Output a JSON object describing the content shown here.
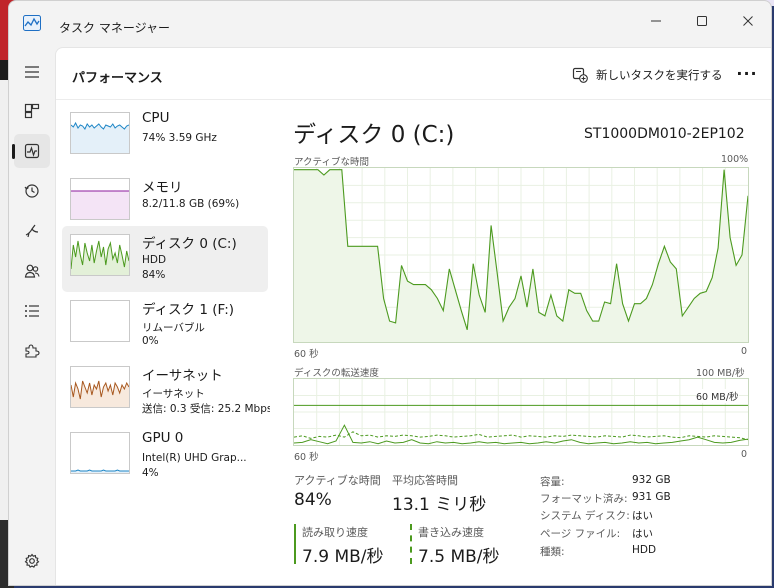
{
  "window": {
    "title": "タスク マネージャー"
  },
  "header": {
    "title": "パフォーマンス",
    "new_task_label": "新しいタスクを実行する",
    "more_label": "···"
  },
  "nav": {
    "items": [
      "menu-icon",
      "processes-icon",
      "performance-icon",
      "app-history-icon",
      "startup-icon",
      "users-icon",
      "details-icon",
      "services-icon",
      "settings-icon"
    ]
  },
  "devices": [
    {
      "name": "CPU",
      "line1": "74%  3.59 GHz",
      "line2": "",
      "color": "#1e86c6",
      "fill": "#e4f0f9"
    },
    {
      "name": "メモリ",
      "line1": "8.2/11.8 GB (69%)",
      "line2": "",
      "color": "#8b1b9c",
      "fill": "#f4e4f6"
    },
    {
      "name": "ディスク 0 (C:)",
      "line1": "HDD",
      "line2": "84%",
      "color": "#4c9a1f",
      "fill": "#e3f0d8"
    },
    {
      "name": "ディスク 1 (F:)",
      "line1": "リムーバブル",
      "line2": "0%",
      "color": "#4c9a1f",
      "fill": "#e3f0d8"
    },
    {
      "name": "イーサネット",
      "line1": "イーサネット",
      "line2": "送信: 0.3  受信: 25.2 Mbps",
      "color": "#a8581f",
      "fill": "#f7e9dd"
    },
    {
      "name": "GPU 0",
      "line1": "Intel(R) UHD Grap...",
      "line2": "4%",
      "color": "#1e86c6",
      "fill": "#e4f0f9"
    }
  ],
  "detail": {
    "title": "ディスク 0 (C:)",
    "model": "ST1000DM010-2EP102",
    "active_time_label": "アクティブな時間",
    "active_time_max": "100%",
    "x_left": "60 秒",
    "x_right": "0",
    "transfer_label": "ディスクの転送速度",
    "transfer_max": "100 MB/秒",
    "transfer_ref": "60 MB/秒",
    "x_left2": "60 秒",
    "x_right2": "0"
  },
  "stats": {
    "active_time_label": "アクティブな時間",
    "active_time_value": "84%",
    "response_label": "平均応答時間",
    "response_value": "13.1 ミリ秒",
    "read_label": "読み取り速度",
    "read_value": "7.9 MB/秒",
    "write_label": "書き込み速度",
    "write_value": "7.5 MB/秒"
  },
  "properties": [
    {
      "label": "容量:",
      "value": "932 GB"
    },
    {
      "label": "フォーマット済み:",
      "value": "931 GB"
    },
    {
      "label": "システム ディスク:",
      "value": "はい"
    },
    {
      "label": "ページ ファイル:",
      "value": "はい"
    },
    {
      "label": "種類:",
      "value": "HDD"
    }
  ],
  "chart_data": [
    {
      "type": "area",
      "title": "アクティブな時間",
      "ylim": [
        0,
        100
      ],
      "y_unit": "%",
      "x_label_left": "60 秒",
      "x_label_right": "0",
      "values": [
        99,
        99,
        99,
        99,
        99,
        96,
        99,
        99,
        99,
        55,
        55,
        55,
        55,
        55,
        55,
        25,
        12,
        11,
        44,
        35,
        33,
        33,
        33,
        30,
        25,
        18,
        42,
        30,
        18,
        7,
        45,
        27,
        17,
        67,
        40,
        12,
        20,
        25,
        38,
        20,
        42,
        17,
        15,
        27,
        15,
        12,
        30,
        28,
        28,
        18,
        12,
        12,
        23,
        22,
        45,
        22,
        12,
        22,
        22,
        25,
        33,
        45,
        55,
        46,
        42,
        15,
        20,
        25,
        28,
        29,
        37,
        54,
        99,
        60,
        44,
        50,
        84
      ]
    },
    {
      "type": "line",
      "title": "ディスクの転送速度",
      "ylim": [
        0,
        100
      ],
      "y_unit": "MB/秒",
      "reference_line": 60,
      "x_label_left": "60 秒",
      "x_label_right": "0",
      "series": [
        {
          "name": "読み取り速度",
          "style": "solid",
          "values": [
            3,
            4,
            8,
            5,
            2,
            6,
            30,
            4,
            3,
            5,
            2,
            6,
            3,
            4,
            8,
            3,
            2,
            5,
            3,
            4,
            2,
            3,
            5,
            3,
            4,
            2,
            3,
            4,
            2,
            3,
            5,
            3,
            6,
            8,
            4,
            2,
            3,
            4,
            2,
            3,
            5,
            3,
            4,
            2,
            3,
            4,
            6,
            8,
            12,
            8,
            4,
            3,
            4,
            7,
            9
          ]
        },
        {
          "name": "書き込み速度",
          "style": "dashed",
          "values": [
            12,
            14,
            10,
            13,
            12,
            15,
            12,
            20,
            14,
            15,
            12,
            14,
            13,
            15,
            14,
            12,
            13,
            15,
            14,
            12,
            13,
            14,
            16,
            12,
            13,
            14,
            15,
            12,
            14,
            13,
            12,
            14,
            13,
            15,
            14,
            13,
            12,
            14,
            13,
            12,
            15,
            14,
            12,
            13,
            14,
            12,
            11,
            14,
            13,
            12,
            14,
            13,
            12,
            11,
            8
          ]
        }
      ]
    }
  ]
}
